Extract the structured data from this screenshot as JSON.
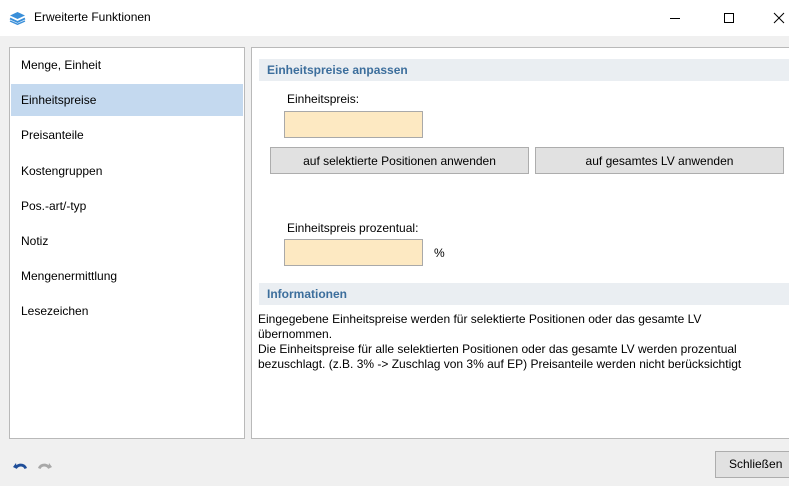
{
  "window": {
    "title": "Erweiterte Funktionen",
    "icon": "layers-icon"
  },
  "nav": {
    "items": [
      {
        "label": "Menge, Einheit",
        "selected": false
      },
      {
        "label": "Einheitspreise",
        "selected": true
      },
      {
        "label": "Preisanteile",
        "selected": false
      },
      {
        "label": "Kostengruppen",
        "selected": false
      },
      {
        "label": "Pos.-art/-typ",
        "selected": false
      },
      {
        "label": "Notiz",
        "selected": false
      },
      {
        "label": "Mengenermittlung",
        "selected": false
      },
      {
        "label": "Lesezeichen",
        "selected": false
      }
    ]
  },
  "main": {
    "section_title": "Einheitspreise anpassen",
    "unit_price_label": "Einheitspreis:",
    "unit_price_value": "",
    "apply_selected_label": "auf selektierte Positionen anwenden",
    "apply_all_label": "auf gesamtes LV anwenden",
    "percent_label": "Einheitspreis prozentual:",
    "percent_value": "",
    "percent_unit": "%",
    "info_title": "Informationen",
    "info_line1": "Eingegebene Einheitspreise werden für selektierte Positionen oder das gesamte LV übernommen.",
    "info_line2": "Die Einheitspreise für alle selektierten Positionen oder das gesamte LV werden prozentual bezuschlagt. (z.B. 3% -> Zuschlag von 3% auf EP) Preisanteile werden nicht berücksichtigt"
  },
  "footer": {
    "undo_icon": "undo-icon",
    "redo_icon": "redo-icon",
    "close_label": "Schließen"
  },
  "colors": {
    "selected_nav": "#c4d9ef",
    "section_header_bg": "#eaeef2",
    "section_header_text": "#3c6e9c",
    "input_bg": "#fde9c2",
    "dialog_bg": "#f0f0f0"
  }
}
